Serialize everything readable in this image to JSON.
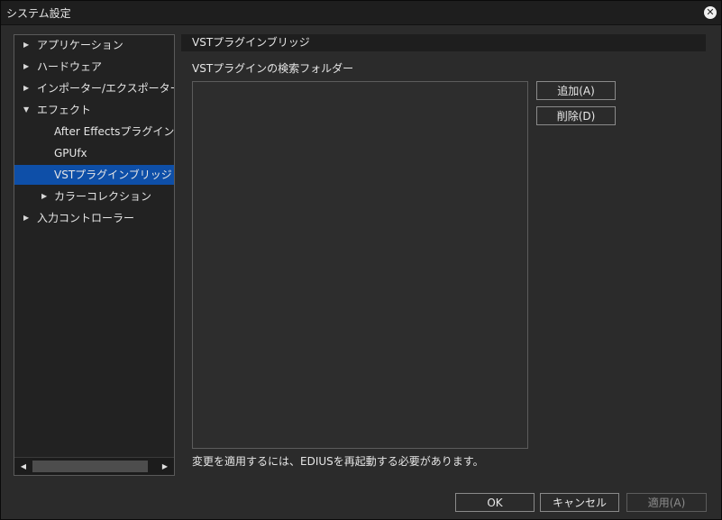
{
  "window": {
    "title": "システム設定"
  },
  "tree": {
    "items": [
      {
        "label": "アプリケーション",
        "arrow": "▶",
        "level": 0
      },
      {
        "label": "ハードウェア",
        "arrow": "▶",
        "level": 0
      },
      {
        "label": "インポーター/エクスポーター",
        "arrow": "▶",
        "level": 0
      },
      {
        "label": "エフェクト",
        "arrow": "▼",
        "level": 0
      },
      {
        "label": "After Effectsプラグインブリッジ",
        "arrow": "",
        "level": 1
      },
      {
        "label": "GPUfx",
        "arrow": "",
        "level": 1
      },
      {
        "label": "VSTプラグインブリッジ",
        "arrow": "",
        "level": 1,
        "selected": true
      },
      {
        "label": "カラーコレクション",
        "arrow": "▶",
        "level": 1
      },
      {
        "label": "入力コントローラー",
        "arrow": "▶",
        "level": 0
      }
    ],
    "scroll_left": "◀",
    "scroll_right": "▶"
  },
  "panel": {
    "header": "VSTプラグインブリッジ",
    "folder_label": "VSTプラグインの検索フォルダー",
    "add_button": "追加(A)",
    "delete_button": "削除(D)",
    "notice": "変更を適用するには、EDIUSを再起動する必要があります。"
  },
  "footer": {
    "ok": "OK",
    "cancel": "キャンセル",
    "apply": "適用(A)"
  },
  "colors": {
    "background": "#2b2b2b",
    "selection": "#0e4fa8",
    "titlebar": "#1e1e1e"
  }
}
